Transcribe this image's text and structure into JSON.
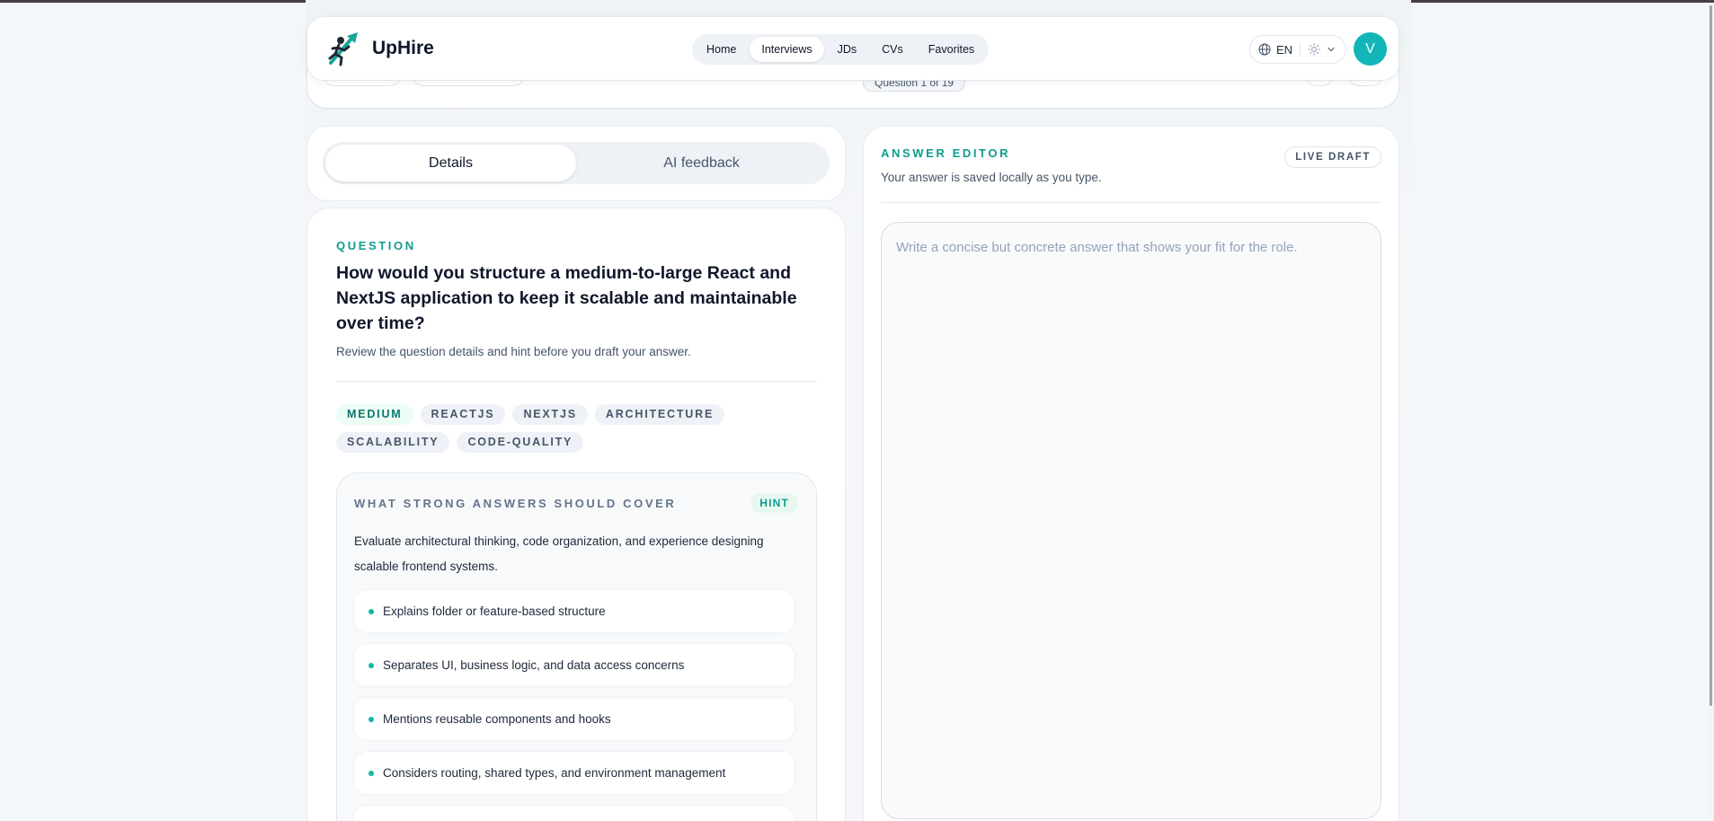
{
  "app": {
    "brand": "UpHire",
    "logo_icon": "runner-arrow-logo-icon"
  },
  "nav": {
    "items": [
      {
        "label": "Home",
        "active": false
      },
      {
        "label": "Interviews",
        "active": true
      },
      {
        "label": "JDs",
        "active": false
      },
      {
        "label": "CVs",
        "active": false
      },
      {
        "label": "Favorites",
        "active": false
      }
    ],
    "language": "EN",
    "avatar_initial": "V"
  },
  "subheader": {
    "question_counter": "Question 1 of 19"
  },
  "tabs": [
    {
      "label": "Details",
      "active": true
    },
    {
      "label": "AI feedback",
      "active": false
    }
  ],
  "question": {
    "eyebrow": "QUESTION",
    "title": "How would you structure a medium-to-large React and NextJS application to keep it scalable and maintainable over time?",
    "subtitle": "Review the question details and hint before you draft your answer.",
    "tags": [
      {
        "label": "MEDIUM",
        "level": true
      },
      {
        "label": "REACTJS",
        "level": false
      },
      {
        "label": "NEXTJS",
        "level": false
      },
      {
        "label": "ARCHITECTURE",
        "level": false
      },
      {
        "label": "SCALABILITY",
        "level": false
      },
      {
        "label": "CODE-QUALITY",
        "level": false
      }
    ],
    "hint": {
      "heading": "WHAT STRONG ANSWERS SHOULD COVER",
      "badge": "HINT",
      "description": "Evaluate architectural thinking, code organization, and experience designing scalable frontend systems.",
      "points": [
        "Explains folder or feature-based structure",
        "Separates UI, business logic, and data access concerns",
        "Mentions reusable components and hooks",
        "Considers routing, shared types, and environment management",
        ""
      ]
    }
  },
  "answer_editor": {
    "eyebrow": "ANSWER EDITOR",
    "subtitle": "Your answer is saved locally as you type.",
    "badge": "LIVE DRAFT",
    "placeholder": "Write a concise but concrete answer that shows your fit for the role.",
    "value": ""
  },
  "colors": {
    "accent": "#0f9d8f",
    "avatar": "#12b5b8",
    "page_bg": "#f3f6fa"
  }
}
